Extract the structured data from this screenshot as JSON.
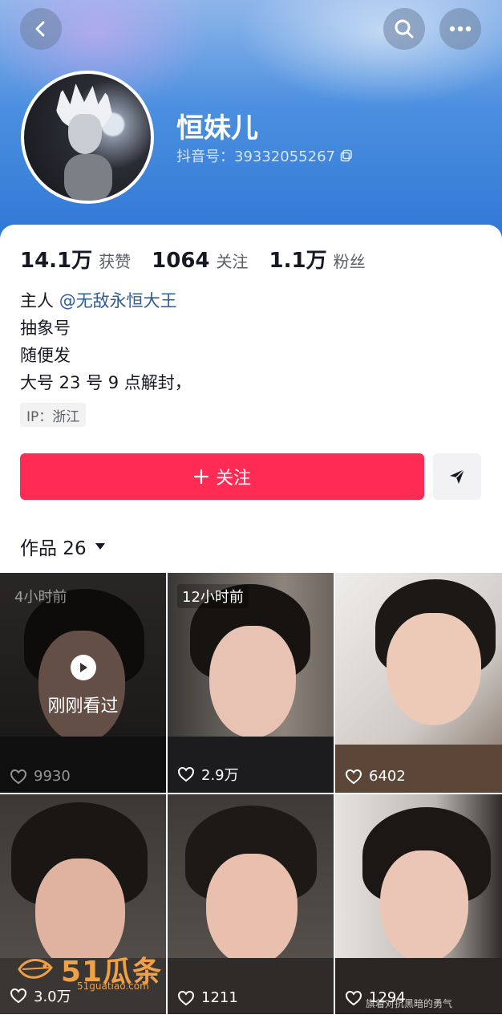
{
  "header": {
    "nickname": "恒妹儿",
    "account_label": "抖音号：39332055267",
    "icons": {
      "back": "chevron-left-icon",
      "search": "search-icon",
      "more": "more-dots-icon",
      "copy": "copy-icon"
    }
  },
  "stats": [
    {
      "value": "14.1万",
      "label": "获赞"
    },
    {
      "value": "1064",
      "label": "关注"
    },
    {
      "value": "1.1万",
      "label": "粉丝"
    }
  ],
  "bio": {
    "line1_prefix": "主人 ",
    "mention": "@无敌永恒大王",
    "line2": "抽象号",
    "line3": "随便发",
    "line4": "大号 23 号 9 点解封，"
  },
  "ip_tag": "IP：浙江",
  "actions": {
    "follow_label": "关注",
    "follow_icon": "plus-icon",
    "share_icon": "send-icon"
  },
  "works": {
    "label": "作品 26",
    "dropdown_icon": "caret-down-icon"
  },
  "videos": [
    {
      "time_badge": "4小时前",
      "likes": "9930",
      "played_label": "刚刚看过",
      "watched": true
    },
    {
      "time_badge": "12小时前",
      "likes": "2.9万",
      "watched": false
    },
    {
      "time_badge": "",
      "likes": "6402",
      "watched": false
    },
    {
      "time_badge": "",
      "likes": "3.0万",
      "watched": false
    },
    {
      "time_badge": "",
      "likes": "1211",
      "watched": false
    },
    {
      "time_badge": "",
      "likes": "1294",
      "watched": false
    }
  ],
  "watermark": {
    "text": "51瓜条",
    "sub": "51guatiao.com"
  },
  "overlay_caption": "旗着对抗黑暗的勇气",
  "colors": {
    "accent": "#fe2c55",
    "mention": "#2f5d9a",
    "header_blue": "#2f78d6"
  }
}
